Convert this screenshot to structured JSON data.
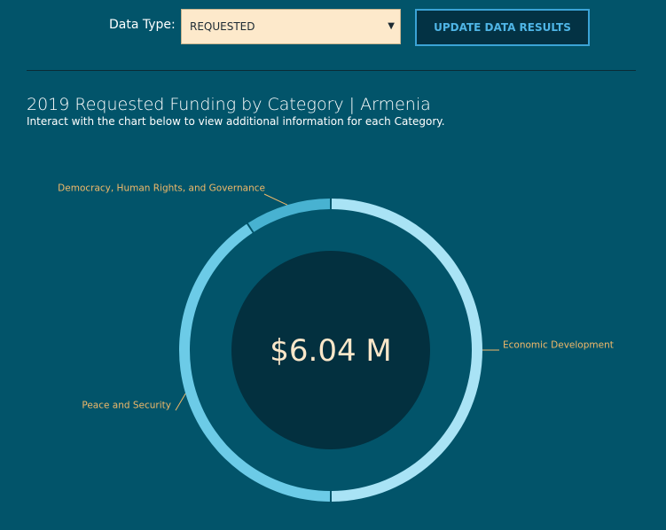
{
  "controls": {
    "data_type_label": "Data Type:",
    "data_type_value": "REQUESTED",
    "update_button": "UPDATE DATA RESULTS"
  },
  "colors": {
    "background": "#02546a",
    "center": "#03303f",
    "label": "#f1b969",
    "total": "#fbe7c9"
  },
  "chart_data": {
    "type": "pie",
    "title": "2019 Requested Funding by Category | Armenia",
    "subtitle": "Interact with the chart below to view additional information for each Category.",
    "center_total": "$6.04 M",
    "categories": [
      "Economic Development",
      "Peace and Security",
      "Democracy, Human Rights, and Governance"
    ],
    "values": [
      3.02,
      2.46,
      0.56
    ],
    "unit": "M",
    "colors": [
      "#a9e3f5",
      "#6ccbe7",
      "#48b2d1"
    ]
  }
}
